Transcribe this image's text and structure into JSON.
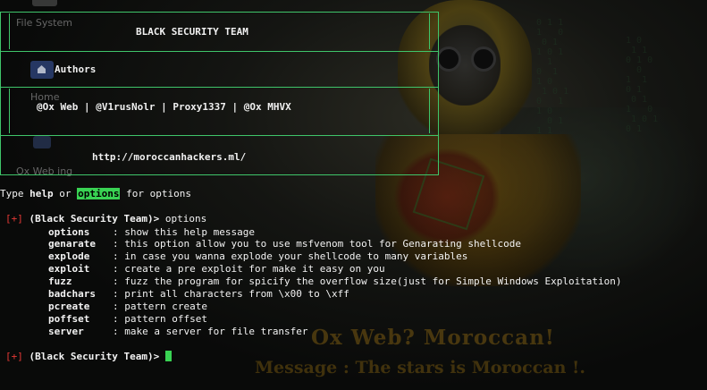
{
  "desktop": {
    "file_system_label": "File System",
    "home_label": "Home",
    "ox_web_label": "Ox Web ing"
  },
  "wallpaper": {
    "line1": "Ox Web? Moroccan!",
    "line2": "Message : The stars is Moroccan !."
  },
  "banner": {
    "team": "BLACK SECURITY TEAM",
    "authors_heading": "Authors",
    "authors": "@Ox Web | @V1rusNolr | Proxy1337 | @Ox MHVX",
    "url": "http://moroccanhackers.ml/"
  },
  "help_hint": {
    "type": "Type",
    "help": "help",
    "or": "or",
    "options": "options",
    "for_options": "for options"
  },
  "prompt": {
    "marker": "[+]",
    "name": "(Black Security Team)>",
    "first_command": "options"
  },
  "options": [
    {
      "name": "options",
      "sep": ":",
      "desc": "show this help message"
    },
    {
      "name": "genarate",
      "sep": ":",
      "desc": "this option allow you to use msfvenom tool for Genarating shellcode"
    },
    {
      "name": "explode",
      "sep": ":",
      "desc": "in case you wanna explode your shellcode to many variables"
    },
    {
      "name": "exploit",
      "sep": ":",
      "desc": "create a pre exploit for make it easy on you"
    },
    {
      "name": "fuzz",
      "sep": ":",
      "desc": "fuzz the program for spicify the overflow size(just for Simple Windows Exploitation)"
    },
    {
      "name": "badchars",
      "sep": ":",
      "desc": "print all characters from \\x00 to \\xff"
    },
    {
      "name": "pcreate",
      "sep": ":",
      "desc": "pattern create"
    },
    {
      "name": "poffset",
      "sep": ":",
      "desc": "pattern offset"
    },
    {
      "name": "server",
      "sep": ":",
      "desc": "make a server for file transfer"
    }
  ],
  "colors": {
    "accent_green": "#39d353",
    "border_green": "#3fc56a",
    "prompt_red": "#e53935",
    "text": "#f2f2f2"
  }
}
